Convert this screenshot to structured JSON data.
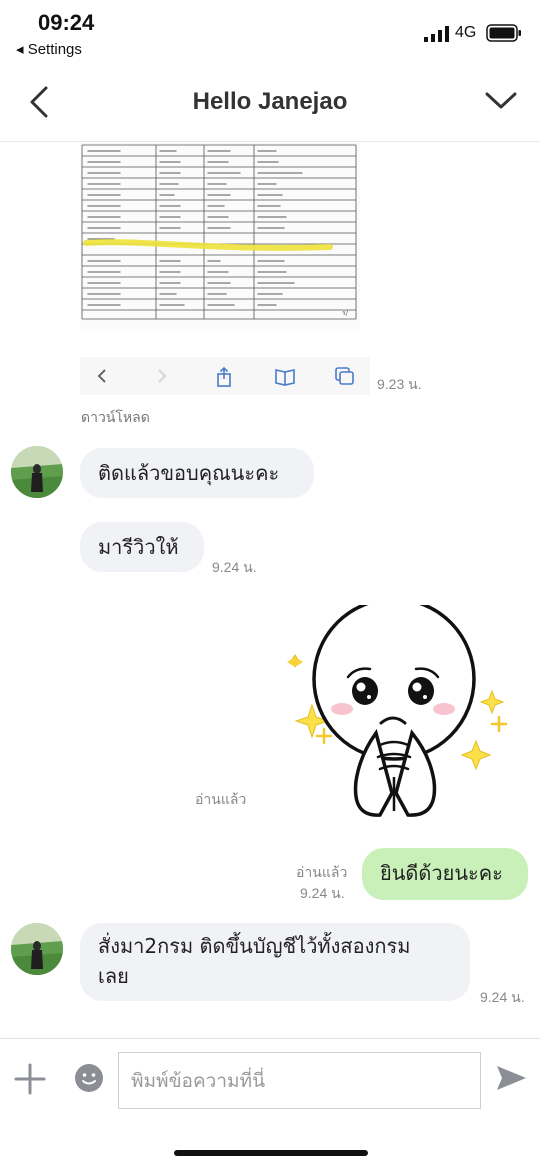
{
  "status_bar": {
    "time": "09:24",
    "back_label": "◂ Settings",
    "network": "4G"
  },
  "header": {
    "title": "Hello Janejao",
    "back_icon": "chevron-left-icon",
    "menu_icon": "chevron-down-icon"
  },
  "messages": {
    "image_time": "9.23 น.",
    "download_label": "ดาวน์โหลด",
    "msg1": "ติดแล้วขอบคุณนะคะ",
    "msg2": "มารีวิวให้",
    "msg2_time": "9.24 น.",
    "sticker_read": "อ่านแล้ว",
    "msg3": "ยินดีด้วยนะคะ",
    "msg3_read": "อ่านแล้ว",
    "msg3_time": "9.24 น.",
    "msg4_line1": "สั่งมา2กรม ติดขึ้นบัญชีไว้ทั้งสองกรม",
    "msg4_line2": "เลย",
    "msg4_time": "9.24 น."
  },
  "input": {
    "placeholder": "พิมพ์ข้อความที่นี่"
  },
  "colors": {
    "my_bubble": "#c9f0b8",
    "their_bubble": "#f1f2f6",
    "icon_gray": "#8b8f95"
  }
}
